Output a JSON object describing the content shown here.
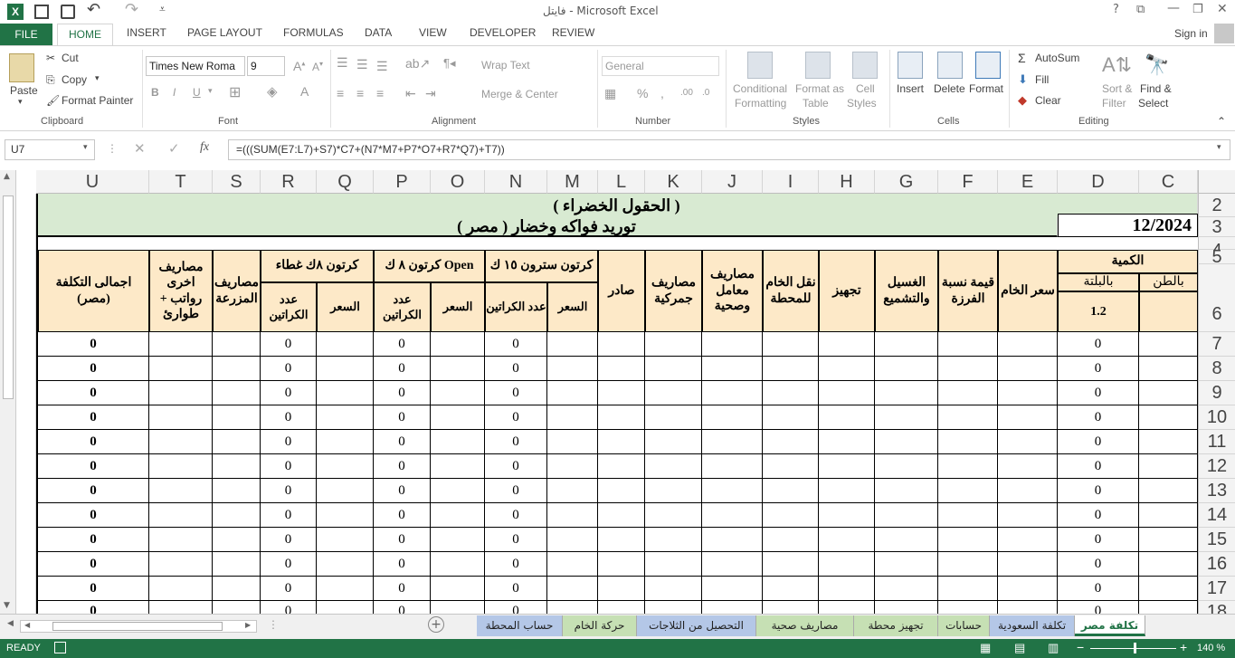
{
  "window": {
    "title": "فايتل - Microsoft Excel",
    "sign_in": "Sign in"
  },
  "tabs": [
    "FILE",
    "HOME",
    "INSERT",
    "PAGE LAYOUT",
    "FORMULAS",
    "DATA",
    "VIEW",
    "DEVELOPER",
    "REVIEW"
  ],
  "ribbon": {
    "clipboard": {
      "paste": "Paste",
      "cut": "Cut",
      "copy": "Copy",
      "format_painter": "Format Painter",
      "label": "Clipboard"
    },
    "font": {
      "name": "Times New Roma",
      "size": "9",
      "label": "Font",
      "bold": "B",
      "italic": "I",
      "underline": "U"
    },
    "alignment": {
      "wrap": "Wrap Text",
      "merge": "Merge & Center",
      "label": "Alignment"
    },
    "number": {
      "format": "General",
      "label": "Number"
    },
    "styles": {
      "cond1": "Conditional",
      "cond2": "Formatting",
      "fmt1": "Format as",
      "fmt2": "Table",
      "cell1": "Cell",
      "cell2": "Styles",
      "label": "Styles"
    },
    "cells": {
      "insert": "Insert",
      "delete": "Delete",
      "format": "Format",
      "label": "Cells"
    },
    "editing": {
      "autosum": "AutoSum",
      "fill": "Fill",
      "clear": "Clear",
      "sort1": "Sort &",
      "sort2": "Filter",
      "find1": "Find &",
      "find2": "Select",
      "label": "Editing"
    }
  },
  "formula_bar": {
    "name_box": "U7",
    "fx": "fx",
    "formula": "=(((SUM(E7:L7)+S7)*C7+(N7*M7+P7*O7+R7*Q7)+T7))"
  },
  "columns": [
    "U",
    "T",
    "S",
    "R",
    "Q",
    "P",
    "O",
    "N",
    "M",
    "L",
    "K",
    "J",
    "I",
    "H",
    "G",
    "F",
    "E",
    "D",
    "C"
  ],
  "rows": [
    "2",
    "3",
    "4",
    "5",
    "6",
    "7",
    "8",
    "9",
    "10",
    "11",
    "12",
    "13",
    "14",
    "15",
    "16",
    "17",
    "18"
  ],
  "sheet": {
    "title1": "( الحقول الخضراء )",
    "title2": "توريد فواكه وخضار    ( مصر )",
    "date": "12/2024",
    "h_total": "اجمالى التكلفة (مصر)",
    "h_other": "مصاريف اخرى رواتب + طوارئ",
    "h_farm": "مصاريف المزرعة",
    "h_carton8c": "كرتون ٨ك غطاء",
    "h_carton8o": "كرتون ٨ ك Open",
    "h_carton15": "كرتون سترون ١٥ ك",
    "h_count": "عدد الكراتين",
    "h_price": "السعر",
    "h_export": "صادر",
    "h_customs": "مصاريف جمركية",
    "h_lab": "مصاريف معامل وصحية",
    "h_transport": "نقل الخام للمحطة",
    "h_prep": "تجهيز",
    "h_wash": "الغسيل والتشميع",
    "h_sort": "قيمة نسبة الفرزة",
    "h_raw": "سعر الخام",
    "h_qty": "الكمية",
    "h_pallet": "بالبلتة",
    "h_ton": "بالطن",
    "pallet_val": "1.2",
    "zero": "0"
  },
  "sheet_tabs": [
    "تكلفة مصر",
    "تكلفة السعودية",
    "حسابات",
    "تجهيز محطة",
    "مصاريف صحية",
    "التحصيل من الثلاجات",
    "حركة الخام",
    "حساب المحطة"
  ],
  "status": {
    "ready": "READY",
    "zoom": "140 %"
  }
}
